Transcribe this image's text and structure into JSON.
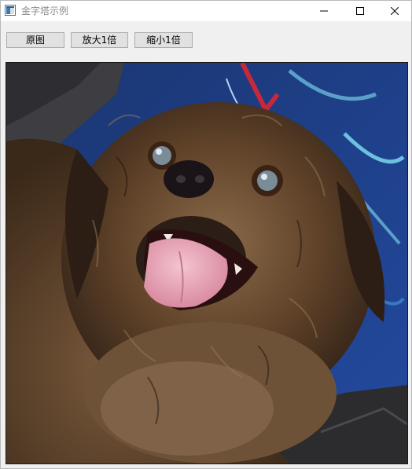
{
  "window": {
    "title": "金字塔示例"
  },
  "toolbar": {
    "original_label": "原图",
    "zoom_in_label": "放大1倍",
    "zoom_out_label": "缩小1倍"
  },
  "image": {
    "subject": "dog-photo-icon",
    "accent_colors": {
      "blanket_blue": "#1f3f8f",
      "fur_brown": "#6b4a2c",
      "tongue_pink": "#e9a6b8"
    }
  }
}
